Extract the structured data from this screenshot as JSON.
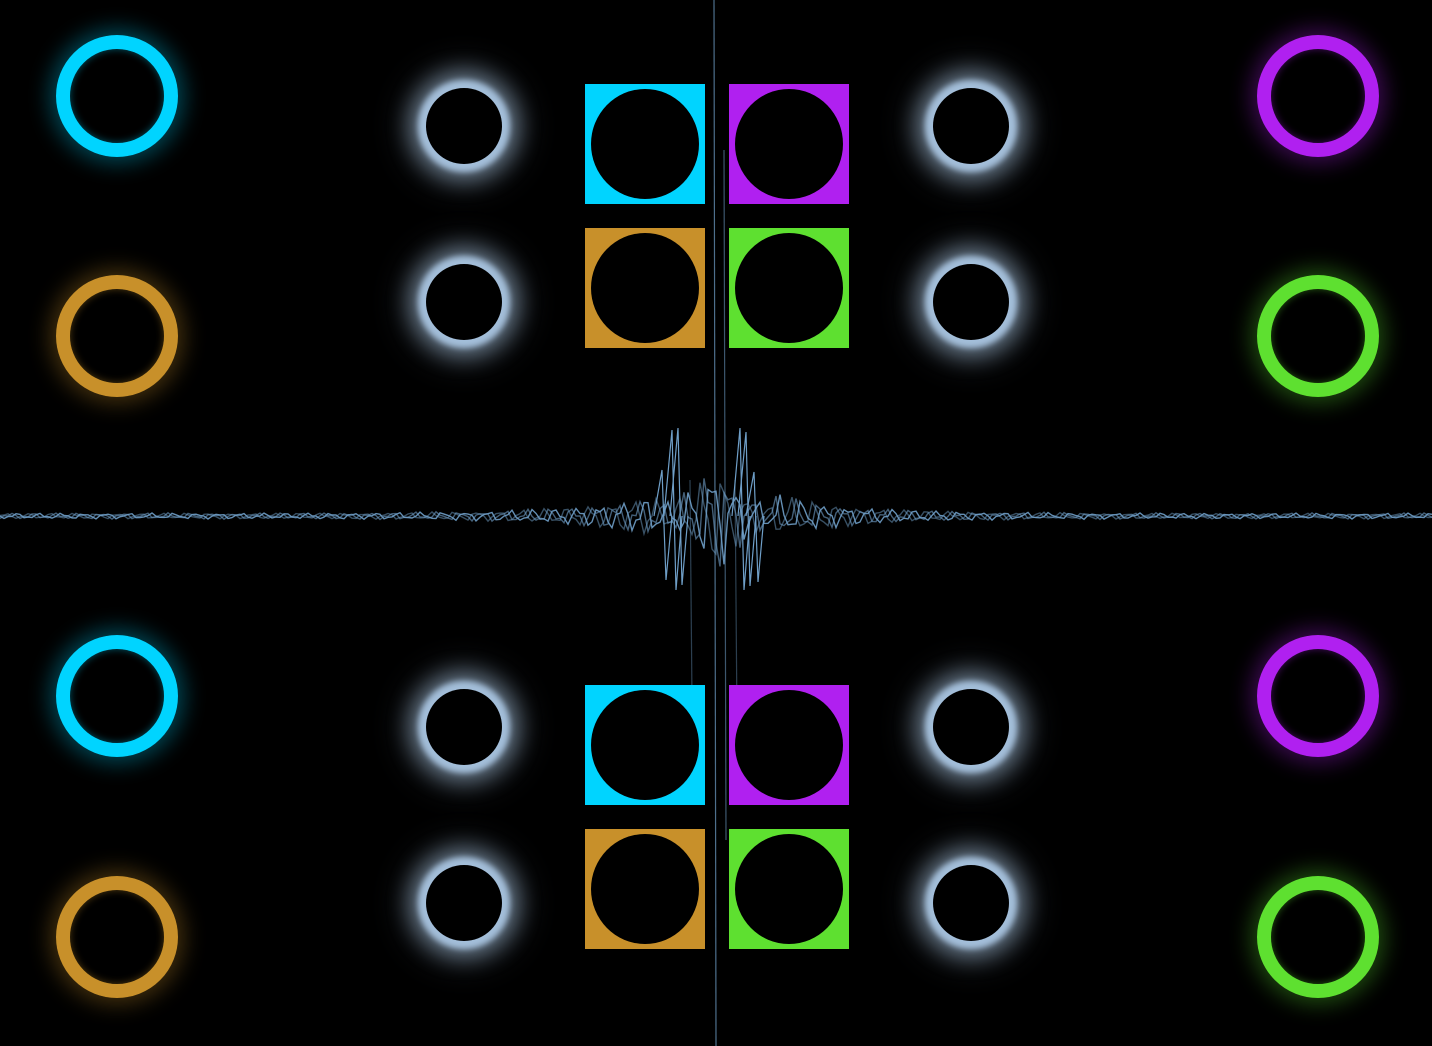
{
  "palette": {
    "cyan": "#00d4ff",
    "purple": "#b020f0",
    "orange": "#c8902a",
    "green": "#5ee030",
    "pale_blue": "#a8c4e0",
    "background": "#000000",
    "waveform": "#6f9fc8"
  },
  "corner_rings": [
    {
      "id": "top-left-upper",
      "color": "cyan",
      "icon": "cyan-ring-icon"
    },
    {
      "id": "top-left-lower",
      "color": "orange",
      "icon": "orange-ring-icon"
    },
    {
      "id": "top-right-upper",
      "color": "purple",
      "icon": "purple-ring-icon"
    },
    {
      "id": "top-right-lower",
      "color": "green",
      "icon": "green-ring-icon"
    },
    {
      "id": "bottom-left-upper",
      "color": "cyan",
      "icon": "cyan-ring-icon"
    },
    {
      "id": "bottom-left-lower",
      "color": "orange",
      "icon": "orange-ring-icon"
    },
    {
      "id": "bottom-right-upper",
      "color": "purple",
      "icon": "purple-ring-icon"
    },
    {
      "id": "bottom-right-lower",
      "color": "green",
      "icon": "green-ring-icon"
    }
  ],
  "pads": [
    {
      "id": "top-cyan",
      "color": "cyan"
    },
    {
      "id": "top-purple",
      "color": "purple"
    },
    {
      "id": "top-orange",
      "color": "orange"
    },
    {
      "id": "top-green",
      "color": "green"
    },
    {
      "id": "bottom-cyan",
      "color": "cyan"
    },
    {
      "id": "bottom-purple",
      "color": "purple"
    },
    {
      "id": "bottom-orange",
      "color": "orange"
    },
    {
      "id": "bottom-green",
      "color": "green"
    }
  ],
  "glow_orbs": [
    {
      "id": "top-left-upper",
      "color": "pale_blue"
    },
    {
      "id": "top-left-lower",
      "color": "pale_blue"
    },
    {
      "id": "top-right-upper",
      "color": "pale_blue"
    },
    {
      "id": "top-right-lower",
      "color": "pale_blue"
    },
    {
      "id": "bottom-left-upper",
      "color": "pale_blue"
    },
    {
      "id": "bottom-left-lower",
      "color": "pale_blue"
    },
    {
      "id": "bottom-right-upper",
      "color": "pale_blue"
    },
    {
      "id": "bottom-right-lower",
      "color": "pale_blue"
    }
  ],
  "waveform": {
    "icon": "waveform-icon",
    "color": "waveform"
  }
}
